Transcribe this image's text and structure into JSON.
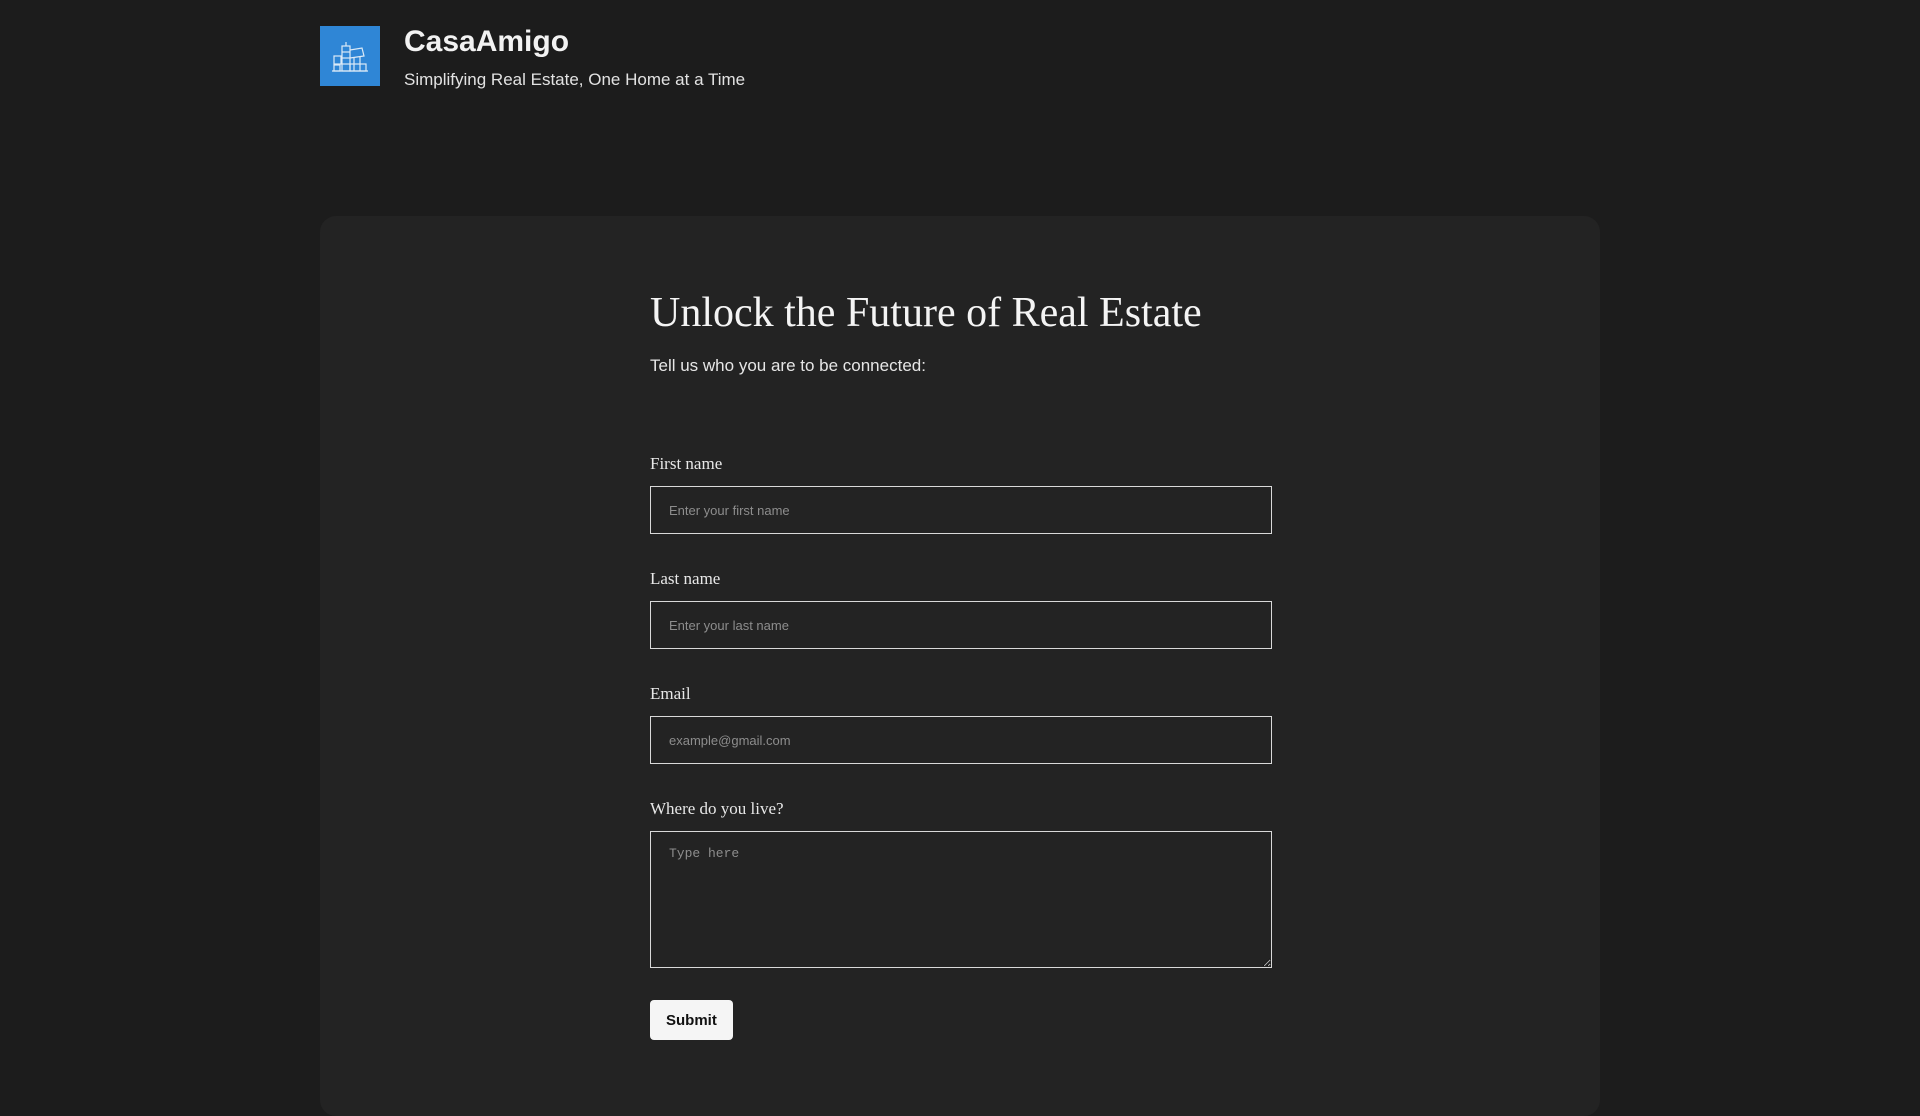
{
  "header": {
    "brand_name": "CasaAmigo",
    "tagline": "Simplifying Real Estate, One Home at a Time",
    "logo_icon": "building-icon",
    "logo_color": "#2f86d6"
  },
  "form": {
    "title": "Unlock the Future of Real Estate",
    "subtitle": "Tell us who you are to be connected:",
    "first_name": {
      "label": "First name",
      "value": "",
      "placeholder": "Enter your first name"
    },
    "last_name": {
      "label": "Last name",
      "value": "",
      "placeholder": "Enter your last name"
    },
    "email": {
      "label": "Email",
      "value": "",
      "placeholder": "example@gmail.com"
    },
    "location": {
      "label": "Where do you live?",
      "value": "",
      "placeholder": "Type here"
    },
    "submit_label": "Submit"
  },
  "colors": {
    "page_background": "#1c1c1c",
    "card_background": "#232323",
    "accent": "#2f86d6"
  }
}
